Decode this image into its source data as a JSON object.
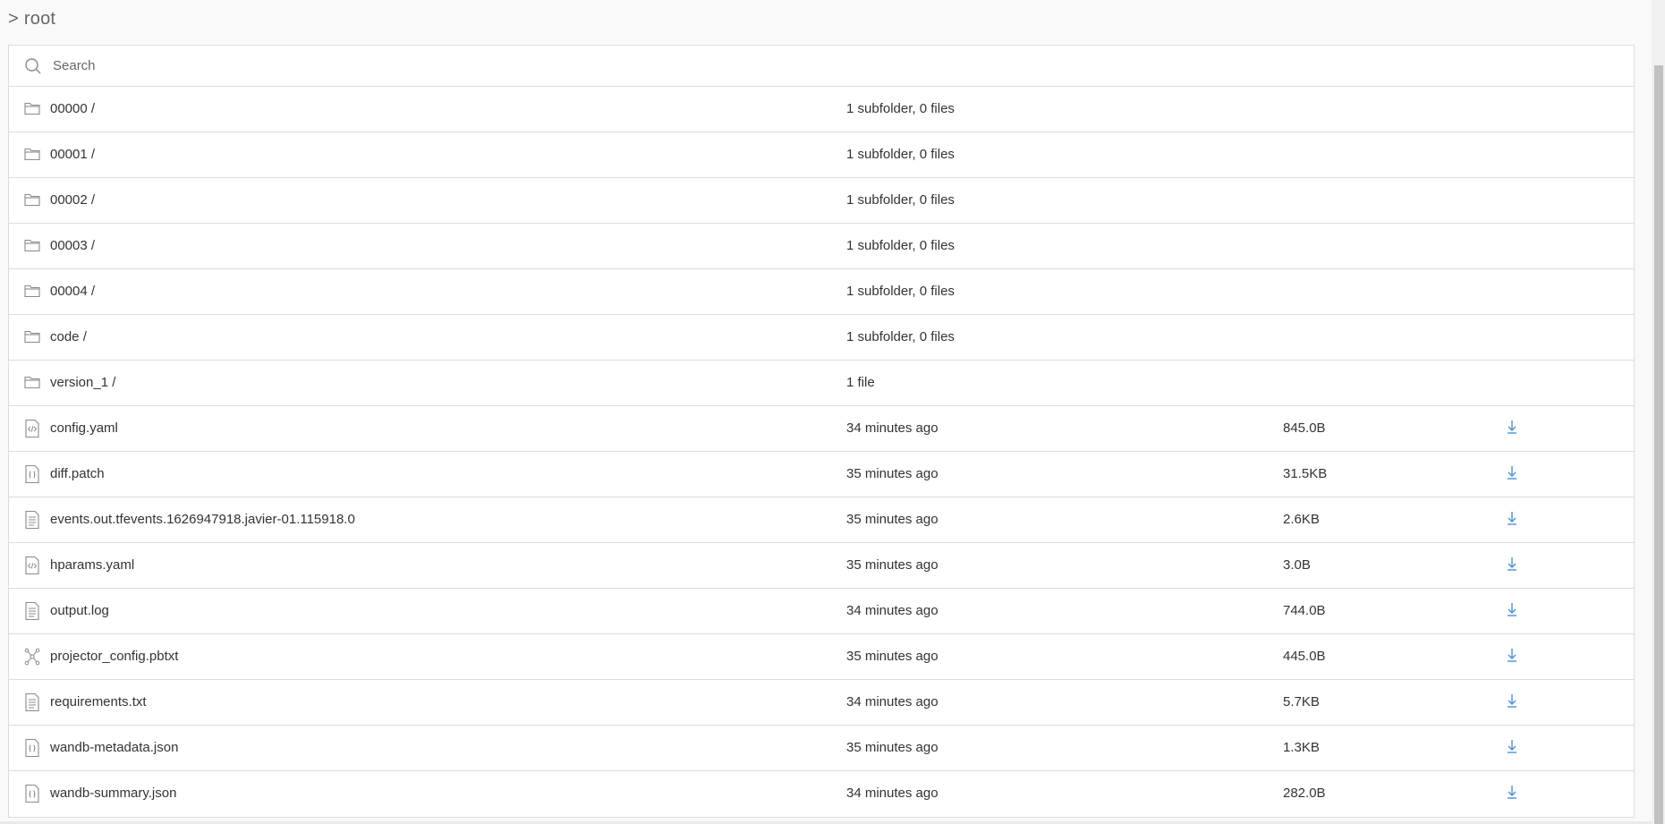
{
  "breadcrumb": {
    "separator": ">",
    "label": "root"
  },
  "search": {
    "placeholder": "Search"
  },
  "folders": [
    {
      "name": "00000 /",
      "meta": "1 subfolder, 0 files"
    },
    {
      "name": "00001 /",
      "meta": "1 subfolder, 0 files"
    },
    {
      "name": "00002 /",
      "meta": "1 subfolder, 0 files"
    },
    {
      "name": "00003 /",
      "meta": "1 subfolder, 0 files"
    },
    {
      "name": "00004 /",
      "meta": "1 subfolder, 0 files"
    },
    {
      "name": "code /",
      "meta": "1 subfolder, 0 files"
    },
    {
      "name": "version_1 /",
      "meta": "1 file"
    }
  ],
  "files": [
    {
      "name": "config.yaml",
      "modified": "34 minutes ago",
      "size": "845.0B",
      "icon": "code-file-icon"
    },
    {
      "name": "diff.patch",
      "modified": "35 minutes ago",
      "size": "31.5KB",
      "icon": "json-file-icon"
    },
    {
      "name": "events.out.tfevents.1626947918.javier-01.115918.0",
      "modified": "35 minutes ago",
      "size": "2.6KB",
      "icon": "text-file-icon"
    },
    {
      "name": "hparams.yaml",
      "modified": "35 minutes ago",
      "size": "3.0B",
      "icon": "code-file-icon"
    },
    {
      "name": "output.log",
      "modified": "34 minutes ago",
      "size": "744.0B",
      "icon": "text-file-icon"
    },
    {
      "name": "projector_config.pbtxt",
      "modified": "35 minutes ago",
      "size": "445.0B",
      "icon": "graph-file-icon"
    },
    {
      "name": "requirements.txt",
      "modified": "34 minutes ago",
      "size": "5.7KB",
      "icon": "text-file-icon"
    },
    {
      "name": "wandb-metadata.json",
      "modified": "35 minutes ago",
      "size": "1.3KB",
      "icon": "json-file-icon"
    },
    {
      "name": "wandb-summary.json",
      "modified": "34 minutes ago",
      "size": "282.0B",
      "icon": "json-file-icon"
    }
  ],
  "colors": {
    "link": "#4a90d9",
    "icon": "#8a8a8a",
    "border": "#dcdcdc"
  }
}
